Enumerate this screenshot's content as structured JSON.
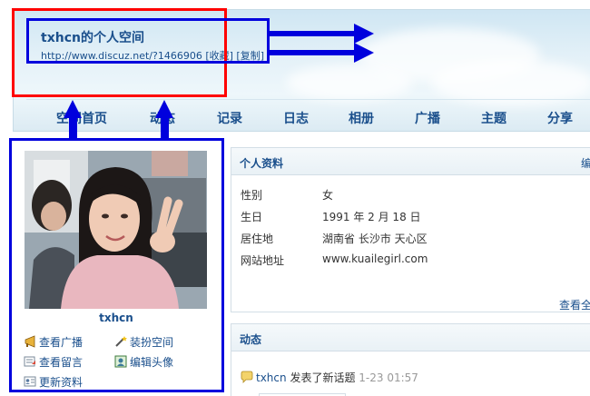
{
  "header": {
    "title": "txhcn的个人空间",
    "url": "http://www.discuz.net/?1466906",
    "bookmark_label": "[收藏]",
    "copy_label": "[复制]"
  },
  "nav": {
    "items": [
      "空间首页",
      "动态",
      "记录",
      "日志",
      "相册",
      "广播",
      "主题",
      "分享"
    ]
  },
  "profile": {
    "username": "txhcn",
    "actions": [
      {
        "label": "查看广播",
        "icon": "megaphone-icon"
      },
      {
        "label": "装扮空间",
        "icon": "magic-wand-icon"
      },
      {
        "label": "查看留言",
        "icon": "message-icon"
      },
      {
        "label": "编辑头像",
        "icon": "picture-icon"
      },
      {
        "label": "更新资料",
        "icon": "profile-card-icon"
      }
    ]
  },
  "info_panel": {
    "title": "个人资料",
    "edit_label": "编",
    "rows": [
      {
        "label": "性别",
        "value": "女"
      },
      {
        "label": "生日",
        "value": "1991 年 2 月 18 日"
      },
      {
        "label": "居住地",
        "value": "湖南省 长沙市 天心区"
      },
      {
        "label": "网站地址",
        "value": "www.kuailegirl.com"
      }
    ],
    "more_label": "查看全"
  },
  "feed_panel": {
    "title": "动态",
    "item": {
      "user": "txhcn",
      "text": " 发表了新话题 ",
      "time": "1-23 01:57"
    }
  },
  "colors": {
    "link": "#1a4f8c",
    "annotation_red": "#ff0000",
    "annotation_blue": "#0000dd"
  }
}
